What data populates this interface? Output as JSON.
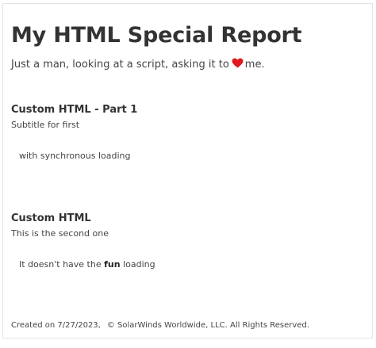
{
  "report": {
    "title": "My HTML Special Report",
    "subtitle_before": "Just a man, looking at a script, asking it to",
    "subtitle_icon": "heart-icon",
    "subtitle_after": "me.",
    "heart_color": "#e0191c"
  },
  "sections": [
    {
      "title": "Custom HTML - Part 1",
      "subtitle": "Subtitle for first",
      "body": "with synchronous loading"
    },
    {
      "title": "Custom HTML",
      "subtitle": "This is the second one",
      "body_before": "It doesn't have the",
      "body_bold": "fun",
      "body_after": "loading"
    }
  ],
  "footer": {
    "created": "Created on 7/27/2023,",
    "copyright": "© SolarWinds Worldwide, LLC. All Rights Reserved."
  }
}
